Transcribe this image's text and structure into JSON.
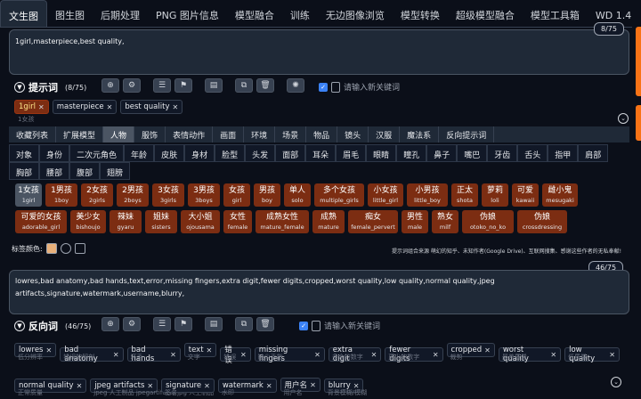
{
  "tabs": [
    "文生图",
    "图生图",
    "后期处理",
    "PNG 图片信息",
    "模型融合",
    "训练",
    "无边图像浏览",
    "模型转换",
    "超级模型融合",
    "模型工具箱",
    "WD 1.4 标签器"
  ],
  "active_tab": 0,
  "prompt": {
    "text": "1girl,masterpiece,best quality,",
    "counter": "8/75",
    "title": "提示词",
    "count": "(8/75)",
    "new_keyword_placeholder": "请输入新关键词",
    "tags": [
      {
        "en": "1girl",
        "cn": "1女孩",
        "highlight": true
      },
      {
        "en": "masterpiece",
        "cn": "",
        "highlight": false
      },
      {
        "en": "best quality",
        "cn": "",
        "highlight": false
      }
    ]
  },
  "categories_nav": [
    "收藏列表",
    "扩展模型",
    "人物",
    "服饰",
    "表情动作",
    "画面",
    "环境",
    "场景",
    "物品",
    "镜头",
    "汉服",
    "魔法系",
    "反向提示词"
  ],
  "active_category": 2,
  "subcategories": [
    "对象",
    "身份",
    "二次元角色",
    "年龄",
    "皮肤",
    "身材",
    "脸型",
    "头发",
    "面部",
    "耳朵",
    "眉毛",
    "眼睛",
    "瞳孔",
    "鼻子",
    "嘴巴",
    "牙齿",
    "舌头",
    "指甲",
    "肩部",
    "胸部",
    "腰部",
    "腹部",
    "翅膀"
  ],
  "words": [
    {
      "cn": "1女孩",
      "en": "1girl",
      "sel": true
    },
    {
      "cn": "1男孩",
      "en": "1boy",
      "sel": false
    },
    {
      "cn": "2女孩",
      "en": "2girls",
      "sel": false
    },
    {
      "cn": "2男孩",
      "en": "2boys",
      "sel": false
    },
    {
      "cn": "3女孩",
      "en": "3girls",
      "sel": false
    },
    {
      "cn": "3男孩",
      "en": "3boys",
      "sel": false
    },
    {
      "cn": "女孩",
      "en": "girl",
      "sel": false
    },
    {
      "cn": "男孩",
      "en": "boy",
      "sel": false
    },
    {
      "cn": "单人",
      "en": "solo",
      "sel": false
    },
    {
      "cn": "多个女孩",
      "en": "multiple_girls",
      "sel": false
    },
    {
      "cn": "小女孩",
      "en": "little_girl",
      "sel": false
    },
    {
      "cn": "小男孩",
      "en": "little_boy",
      "sel": false
    },
    {
      "cn": "正太",
      "en": "shota",
      "sel": false
    },
    {
      "cn": "萝莉",
      "en": "loli",
      "sel": false
    },
    {
      "cn": "可爱",
      "en": "kawaii",
      "sel": false
    },
    {
      "cn": "雌小鬼",
      "en": "mesugaki",
      "sel": false
    },
    {
      "cn": "可爱的女孩",
      "en": "adorable_girl",
      "sel": false
    },
    {
      "cn": "美少女",
      "en": "bishoujo",
      "sel": false
    },
    {
      "cn": "辣妹",
      "en": "gyaru",
      "sel": false
    },
    {
      "cn": "姐妹",
      "en": "sisters",
      "sel": false
    },
    {
      "cn": "大小姐",
      "en": "ojousama",
      "sel": false
    },
    {
      "cn": "女性",
      "en": "female",
      "sel": false
    },
    {
      "cn": "成熟女性",
      "en": "mature_female",
      "sel": false
    },
    {
      "cn": "成熟",
      "en": "mature",
      "sel": false
    },
    {
      "cn": "痴女",
      "en": "female_pervert",
      "sel": false
    },
    {
      "cn": "男性",
      "en": "male",
      "sel": false
    },
    {
      "cn": "熟女",
      "en": "milf",
      "sel": false
    },
    {
      "cn": "伪娘",
      "en": "otoko_no_ko",
      "sel": false
    },
    {
      "cn": "伪娘",
      "en": "crossdressing",
      "sel": false
    }
  ],
  "tag_color_label": "标签颜色:",
  "note": "提示词组合来源 萌幻的知乎、未知作者(Google Drive)、互联网搜集、感谢这些作者的无私奉献!",
  "negative": {
    "text": "lowres,bad anatomy,bad hands,text,error,missing fingers,extra digit,fewer digits,cropped,worst quality,low quality,normal quality,jpeg artifacts,signature,watermark,username,blurry,",
    "counter": "46/75",
    "title": "反向词",
    "count": "(46/75)",
    "new_keyword_placeholder": "请输入新关键词",
    "tags": [
      {
        "en": "lowres",
        "cn": "低分辨率"
      },
      {
        "en": "bad anatomy",
        "cn": "错误的解剖"
      },
      {
        "en": "bad hands",
        "cn": "坏手"
      },
      {
        "en": "text",
        "cn": "文字"
      },
      {
        "en": "错误",
        "cn": "错误"
      },
      {
        "en": "missing fingers",
        "cn": "缺少手指"
      },
      {
        "en": "extra digit",
        "cn": "多余的数字"
      },
      {
        "en": "fewer digits",
        "cn": "更少的数字"
      },
      {
        "en": "cropped",
        "cn": "裁剪"
      },
      {
        "en": "worst quality",
        "cn": "最差质量"
      },
      {
        "en": "low quality",
        "cn": "低质量"
      },
      {
        "en": "normal quality",
        "cn": "正常质量"
      },
      {
        "en": "jpeg artifacts",
        "cn": "jpeg 人工制品 jpegartifacts jpg 人工制品"
      },
      {
        "en": "signature",
        "cn": "签名"
      },
      {
        "en": "watermark",
        "cn": "水印"
      },
      {
        "en": "用户名",
        "cn": "用户名"
      },
      {
        "en": "blurry",
        "cn": "背景模糊/模糊"
      }
    ]
  },
  "colors": {
    "accent": "#f97316",
    "tag_highlight": "#7c2d12",
    "checkbox": "#3b82f6"
  }
}
